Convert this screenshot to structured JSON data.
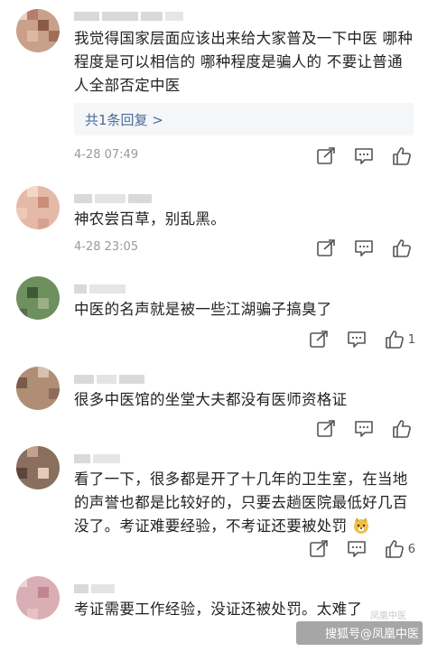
{
  "comments": [
    {
      "text": "我觉得国家层面应该出来给大家普及一下中医 哪种程度是可以相信的 哪种程度是骗人的 不要让普通人全部否定中医",
      "reply_label": "共1条回复 >",
      "time": "4-28 07:49",
      "like_count": ""
    },
    {
      "text": "神农尝百草，别乱黑。",
      "time": "4-28 23:05",
      "like_count": ""
    },
    {
      "text": "中医的名声就是被一些江湖骗子搞臭了",
      "time": "",
      "like_count": "1"
    },
    {
      "text": "很多中医馆的坐堂大夫都没有医师资格证",
      "time": "",
      "like_count": ""
    },
    {
      "text": "看了一下，很多都是开了十几年的卫生室，在当地的声誉也都是比较好的，只要去趟医院最低好几百没了。考证难要经验，不考证还要被处罚",
      "time": "",
      "like_count": "6"
    },
    {
      "text": "考证需要工作经验，没证还被处罚。太难了",
      "time": "",
      "like_count": ""
    }
  ],
  "watermark": {
    "text": "搜狐号@凤凰中医",
    "faint": "凤凰中医"
  },
  "icons": {
    "share": "share-icon",
    "comment": "comment-icon",
    "like": "thumbs-up-icon",
    "emoji": "doge-emoji-icon"
  },
  "colors": {
    "text": "#222222",
    "reply_link": "#4a6b9e",
    "meta": "#9a9a9a",
    "icon": "#555555"
  }
}
